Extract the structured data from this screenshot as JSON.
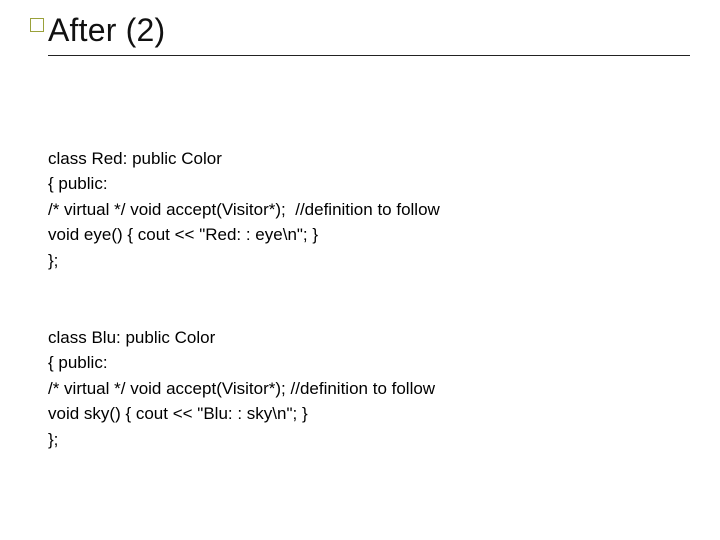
{
  "title": "After (2)",
  "blocks": [
    {
      "lines": [
        "class Red: public Color",
        "{ public:",
        "/* virtual */ void accept(Visitor*);  //definition to follow",
        "void eye() { cout << \"Red: : eye\\n\"; }",
        "};"
      ]
    },
    {
      "lines": [
        "class Blu: public Color",
        "{ public:",
        "/* virtual */ void accept(Visitor*); //definition to follow",
        "void sky() { cout << \"Blu: : sky\\n\"; }",
        "};"
      ]
    }
  ]
}
